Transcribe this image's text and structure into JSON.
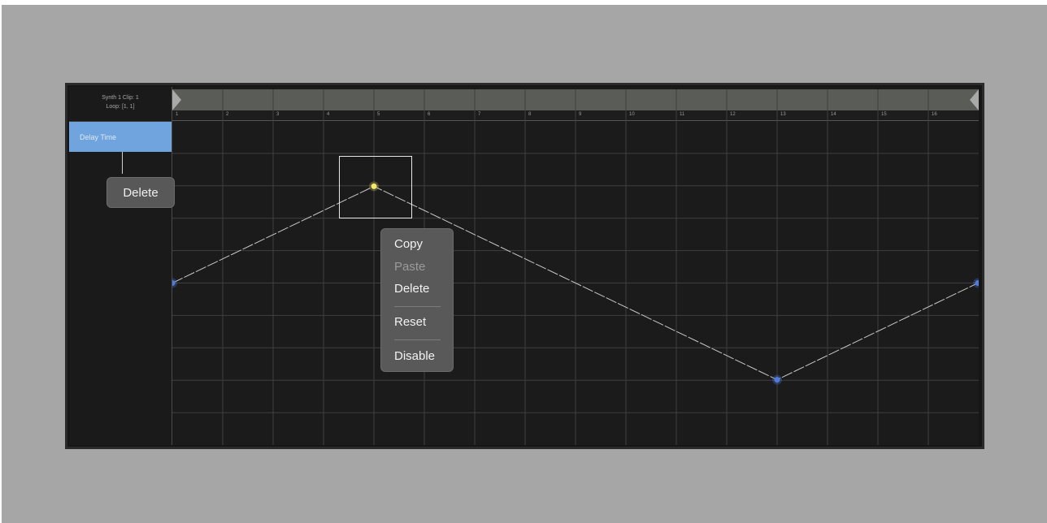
{
  "clip": {
    "title": "Synth 1 Clip: 1",
    "loop": "Loop: [1, 1]"
  },
  "parameter": {
    "label": "Delay Time"
  },
  "ruler": {
    "bars": [
      "1",
      "2",
      "3",
      "4",
      "5",
      "6",
      "7",
      "8",
      "9",
      "10",
      "11",
      "12",
      "13",
      "14",
      "15",
      "16"
    ]
  },
  "automation": {
    "points": [
      {
        "bar": 1,
        "level": 0.5,
        "selected": false
      },
      {
        "bar": 5,
        "level": 0.8,
        "selected": true
      },
      {
        "bar": 13,
        "level": 0.2,
        "selected": false
      },
      {
        "bar": 17,
        "level": 0.5,
        "selected": false
      }
    ]
  },
  "context_menu": {
    "copy": "Copy",
    "paste": "Paste",
    "delete": "Delete",
    "reset": "Reset",
    "disable": "Disable"
  },
  "tooltip": {
    "delete": "Delete"
  },
  "colors": {
    "background": "#a6a6a6",
    "panel": "#1b1b1b",
    "parameter_highlight": "#6fa4de",
    "point": "#4f7bdc",
    "selected_point": "#f4e96a"
  }
}
